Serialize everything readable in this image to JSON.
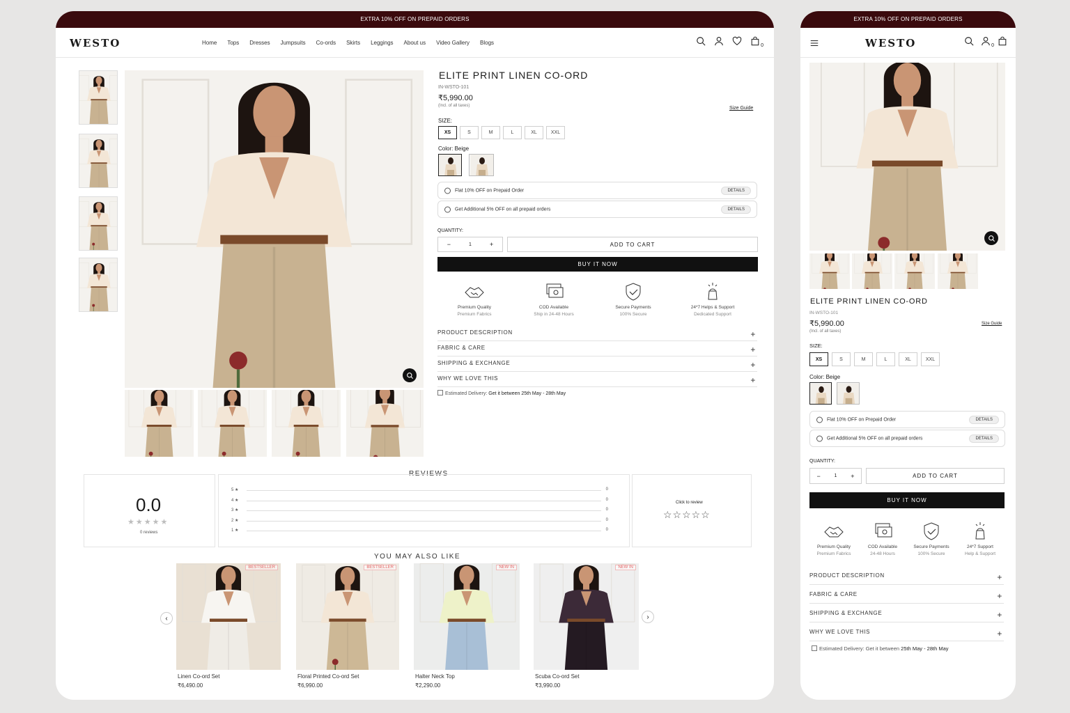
{
  "promo": "EXTRA 10% OFF ON PREPAID ORDERS",
  "brand": "WESTO",
  "nav": [
    "Home",
    "Tops",
    "Dresses",
    "Jumpsuits",
    "Co-ords",
    "Skirts",
    "Leggings",
    "About us",
    "Video Gallery",
    "Blogs"
  ],
  "header": {
    "cart_count": "0",
    "user_count": "0"
  },
  "product": {
    "title": "ELITE PRINT LINEN CO-ORD",
    "sku": "IN-WSTO-101",
    "price": "₹5,990.00",
    "tax_note": "(Incl. of all taxes)",
    "size_guide": "Size Guide",
    "size_label": "SIZE:",
    "sizes": [
      "XS",
      "S",
      "M",
      "L",
      "XL",
      "XXL"
    ],
    "selected_size": "XS",
    "color_label": "Color:",
    "color_value": "Beige",
    "offers": [
      {
        "text": "Flat 10% OFF on Prepaid Order",
        "button": "DETAILS"
      },
      {
        "text": "Get Additional 5% OFF on all prepaid orders",
        "button": "DETAILS"
      }
    ],
    "quantity_label": "QUANTITY:",
    "quantity": "1",
    "add_to_cart": "ADD TO CART",
    "buy_now": "BUY IT NOW",
    "features_desktop": [
      {
        "icon": "handshake-icon",
        "title": "Premium Quality",
        "sub": "Premium Fabrics"
      },
      {
        "icon": "cash-icon",
        "title": "COD Available",
        "sub": "Ship in 24-48 Hours"
      },
      {
        "icon": "shield-check-icon",
        "title": "Secure Payments",
        "sub": "100% Secure"
      },
      {
        "icon": "support-icon",
        "title": "24*7 Helps & Support",
        "sub": "Dedicated Support"
      }
    ],
    "features_mobile": [
      {
        "icon": "handshake-icon",
        "title": "Premium Quality",
        "sub": "Premium Fabrics"
      },
      {
        "icon": "cash-icon",
        "title": "COD Available",
        "sub": "24-48 Hours"
      },
      {
        "icon": "shield-check-icon",
        "title": "Secure Payments",
        "sub": "100% Secure"
      },
      {
        "icon": "support-icon",
        "title": "24*7 Support",
        "sub": "Help & Support"
      }
    ],
    "accordions": [
      "PRODUCT DESCRIPTION",
      "FABRIC & CARE",
      "SHIPPING & EXCHANGE",
      "WHY WE LOVE THIS"
    ],
    "delivery_label": "Estimated Delivery:",
    "delivery_value": "Get it between",
    "delivery_dates": "25th May - 28th May"
  },
  "reviews": {
    "heading": "REVIEWS",
    "average": "0.0",
    "count": "0 reviews",
    "rows": [
      {
        "label": "5 ★",
        "count": "0"
      },
      {
        "label": "4 ★",
        "count": "0"
      },
      {
        "label": "3 ★",
        "count": "0"
      },
      {
        "label": "2 ★",
        "count": "0"
      },
      {
        "label": "1 ★",
        "count": "0"
      }
    ],
    "click_to_review": "Click to review"
  },
  "recommend": {
    "heading": "YOU MAY ALSO LIKE",
    "items": [
      {
        "name": "Linen Co-ord Set",
        "price": "₹6,490.00",
        "badge": "BESTSELLER"
      },
      {
        "name": "Floral Printed Co-ord Set",
        "price": "₹6,990.00",
        "badge": "BESTSELLER"
      },
      {
        "name": "Halter Neck Top",
        "price": "₹2,290.00",
        "badge": "NEW IN"
      },
      {
        "name": "Scuba Co-ord Set",
        "price": "₹3,990.00",
        "badge": "NEW IN"
      }
    ]
  },
  "colors": {
    "promo_bg": "#3a0a0d",
    "buy_btn": "#111111",
    "badge": "#e26060"
  }
}
